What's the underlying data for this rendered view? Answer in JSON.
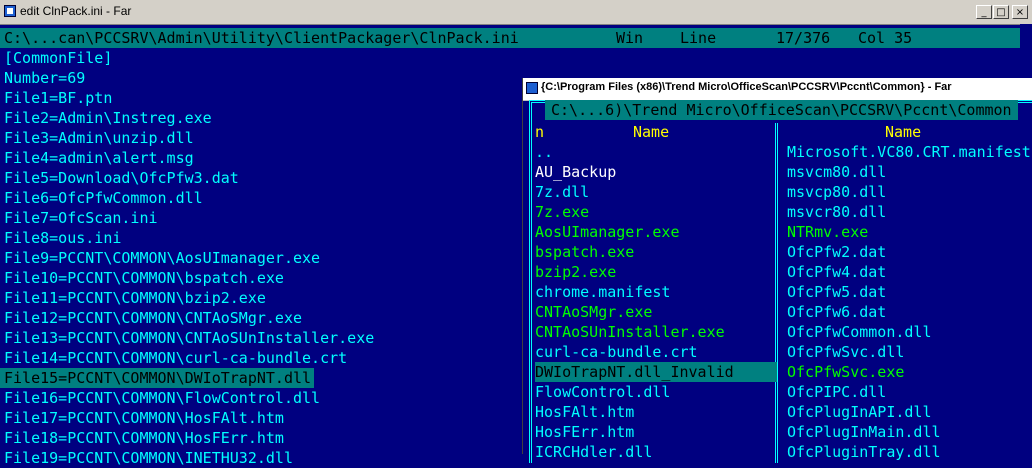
{
  "window": {
    "title": "edit ClnPack.ini - Far",
    "controls": [
      "_",
      "□",
      "×"
    ]
  },
  "editor": {
    "status": {
      "path": "C:\\...can\\PCCSRV\\Admin\\Utility\\ClientPackager\\ClnPack.ini",
      "eol": "Win",
      "line_label": "Line",
      "line_pos": "17/376",
      "col": "Col 35"
    },
    "lines": [
      "[CommonFile]",
      "Number=69",
      "File1=BF.ptn",
      "File2=Admin\\Instreg.exe",
      "File3=Admin\\unzip.dll",
      "File4=admin\\alert.msg",
      "File5=Download\\OfcPfw3.dat",
      "File6=OfcPfwCommon.dll",
      "File7=OfcScan.ini",
      "File8=ous.ini",
      "File9=PCCNT\\COMMON\\AosUImanager.exe",
      "File10=PCCNT\\COMMON\\bspatch.exe",
      "File11=PCCNT\\COMMON\\bzip2.exe",
      "File12=PCCNT\\COMMON\\CNTAoSMgr.exe",
      "File13=PCCNT\\COMMON\\CNTAoSUnInstaller.exe",
      "File14=PCCNT\\COMMON\\curl-ca-bundle.crt",
      "File15=PCCNT\\COMMON\\DWIoTrapNT.dll",
      "File16=PCCNT\\COMMON\\FlowControl.dll",
      "File17=PCCNT\\COMMON\\HosFAlt.htm",
      "File18=PCCNT\\COMMON\\HosFErr.htm",
      "File19=PCCNT\\COMMON\\INETHU32.dll"
    ],
    "selected_line_index": 16
  },
  "panel": {
    "title": "{C:\\Program Files (x86)\\Trend Micro\\OfficeScan\\PCCSRV\\Pccnt\\Common} - Far",
    "path": "C:\\...6)\\Trend Micro\\OfficeScan\\PCCSRV\\Pccnt\\Common",
    "left_header_n": "n",
    "header_name": "Name",
    "left_files": [
      {
        "name": "..",
        "color": "cyan"
      },
      {
        "name": "AU_Backup",
        "color": "white"
      },
      {
        "name": "7z.dll",
        "color": "cyan"
      },
      {
        "name": "7z.exe",
        "color": "green"
      },
      {
        "name": "AosUImanager.exe",
        "color": "green"
      },
      {
        "name": "bspatch.exe",
        "color": "green"
      },
      {
        "name": "bzip2.exe",
        "color": "green"
      },
      {
        "name": "chrome.manifest",
        "color": "cyan"
      },
      {
        "name": "CNTAoSMgr.exe",
        "color": "green"
      },
      {
        "name": "CNTAoSUnInstaller.exe",
        "color": "green"
      },
      {
        "name": "curl-ca-bundle.crt",
        "color": "cyan"
      },
      {
        "name": "DWIoTrapNT.dll_Invalid",
        "color": "selected"
      },
      {
        "name": "FlowControl.dll",
        "color": "cyan"
      },
      {
        "name": "HosFAlt.htm",
        "color": "cyan"
      },
      {
        "name": "HosFErr.htm",
        "color": "cyan"
      },
      {
        "name": "ICRCHdler.dll",
        "color": "cyan"
      }
    ],
    "right_files": [
      {
        "name": "Microsoft.VC80.CRT.manifest",
        "color": "cyan"
      },
      {
        "name": "msvcm80.dll",
        "color": "cyan"
      },
      {
        "name": "msvcp80.dll",
        "color": "cyan"
      },
      {
        "name": "msvcr80.dll",
        "color": "cyan"
      },
      {
        "name": "NTRmv.exe",
        "color": "green"
      },
      {
        "name": "OfcPfw2.dat",
        "color": "cyan"
      },
      {
        "name": "OfcPfw4.dat",
        "color": "cyan"
      },
      {
        "name": "OfcPfw5.dat",
        "color": "cyan"
      },
      {
        "name": "OfcPfw6.dat",
        "color": "cyan"
      },
      {
        "name": "OfcPfwCommon.dll",
        "color": "cyan"
      },
      {
        "name": "OfcPfwSvc.dll",
        "color": "cyan"
      },
      {
        "name": "OfcPfwSvc.exe",
        "color": "green"
      },
      {
        "name": "OfcPIPC.dll",
        "color": "cyan"
      },
      {
        "name": "OfcPlugInAPI.dll",
        "color": "cyan"
      },
      {
        "name": "OfcPlugInMain.dll",
        "color": "cyan"
      },
      {
        "name": "OfcPluginTray.dll",
        "color": "cyan"
      }
    ]
  },
  "colors": {
    "background": "#000080",
    "text": "#00ffff",
    "highlight": "#008080",
    "header": "#ffff00",
    "exec": "#00ff00"
  }
}
